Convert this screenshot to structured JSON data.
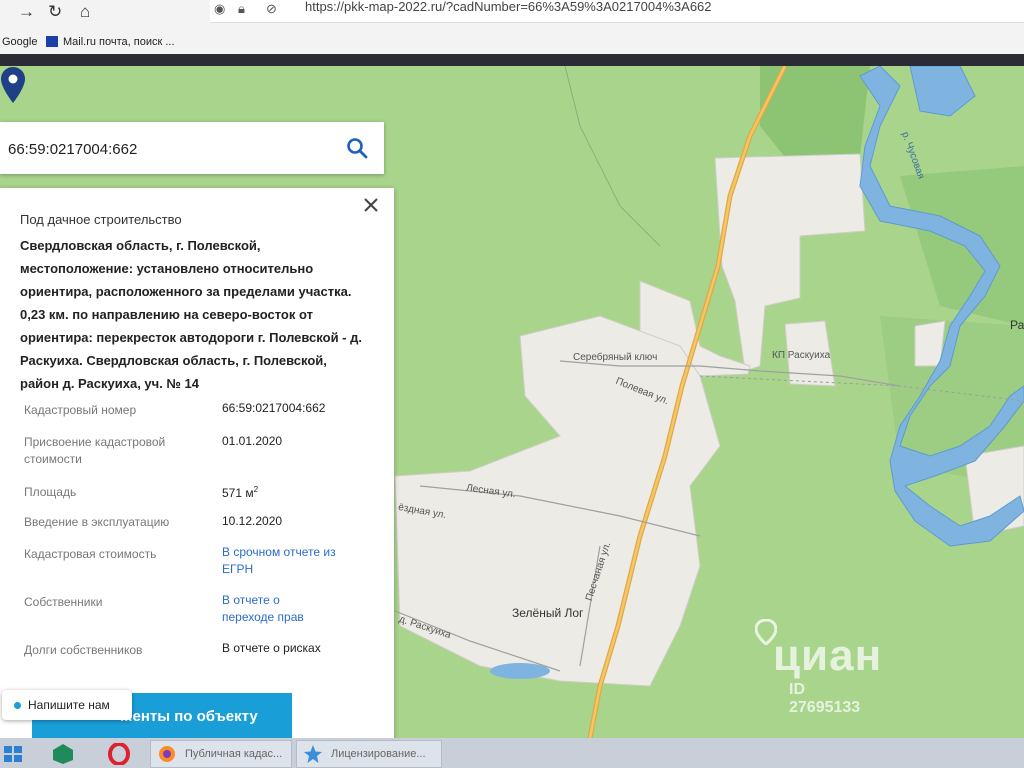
{
  "browser": {
    "url": "https://pkk-map-2022.ru/?cadNumber=66%3A59%3A0217004%3A662",
    "bookmarks": [
      "Google",
      "Mail.ru почта, поиск ..."
    ]
  },
  "search": {
    "value": "66:59:0217004:662"
  },
  "map": {
    "labels": {
      "serebryany": "Серебряный ключ",
      "polevaya": "Полевая ул.",
      "kp_raskuikha": "КП Раскуиха",
      "lesnaya": "Лесная ул.",
      "zvezdnaya": "ёздная ул.",
      "peschanaya": "Песчаная ул.",
      "zeleny_log": "Зелёный Лог",
      "raskuikha_road": "д. Раскуиха",
      "chusovaya": "р. Чусовая",
      "ra": "Ра"
    },
    "watermark": {
      "brand": "циан",
      "id": "ID 27695133"
    }
  },
  "panel": {
    "category": "Под дачное строительство",
    "address": "Свердловская область, г. Полевской, местоположение: установлено относительно ориентира, расположенного за пределами участка. 0,23 км. по направлению на северо-восток от ориентира: перекресток автодороги г. Полевской - д. Раскуиха. Свердловская область, г. Полевской, район д. Раскуиха, уч. № 14",
    "rows": [
      {
        "label": "Кадастровый номер",
        "value": "66:59:0217004:662"
      },
      {
        "label": "Присвоение кадастровой стоимости",
        "value": "01.01.2020"
      },
      {
        "label": "Площадь",
        "value": "571 м",
        "unit_sup": "2"
      },
      {
        "label": "Введение в эксплуатацию",
        "value": "10.12.2020"
      },
      {
        "label": "Кадастровая стоимость",
        "value": "В срочном отчете из ЕГРН"
      },
      {
        "label": "Собственники",
        "value": "В отчете о переходе прав"
      },
      {
        "label": "Долги собственников",
        "value": "В отчете о рисках"
      }
    ],
    "cta_label": "...енты по объекту"
  },
  "chat": {
    "label": "Напишите нам"
  },
  "taskbar": {
    "tasks": [
      "Публичная кадас...",
      "Лицензирование..."
    ]
  }
}
